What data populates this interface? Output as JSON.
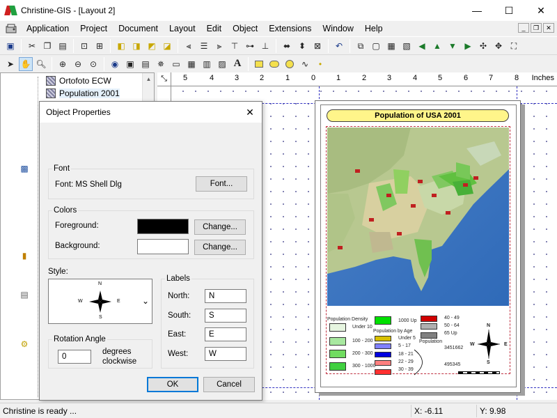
{
  "window": {
    "title": "Christine-GIS - [Layout 2]",
    "minimize": "—",
    "maximize": "☐",
    "close": "✕"
  },
  "menu": {
    "items": [
      "Application",
      "Project",
      "Document",
      "Layout",
      "Edit",
      "Object",
      "Extensions",
      "Window",
      "Help"
    ],
    "mdi": {
      "minimize": "_",
      "restore": "❐",
      "close": "✕"
    }
  },
  "tree": {
    "items": [
      {
        "label": "Ortofoto ECW",
        "selected": false
      },
      {
        "label": "Population 2001",
        "selected": true
      }
    ]
  },
  "ruler": {
    "ticks": [
      "5",
      "4",
      "3",
      "2",
      "1",
      "0",
      "1",
      "2",
      "3",
      "4",
      "5",
      "6",
      "7",
      "8"
    ],
    "unit": "Inches"
  },
  "layout": {
    "map_title": "Population of USA 2001",
    "legend": {
      "density_title": "Population Density",
      "density_items": [
        "Under 10",
        "100 - 200",
        "200 - 300",
        "300 - 1000"
      ],
      "density_extra": "1000 Up",
      "age_title": "Population by Age",
      "age_items": [
        "Under 5",
        "5 - 17",
        "18 - 21",
        "22 - 29",
        "30 - 39"
      ],
      "age_items_right": [
        "40 - 49",
        "50 - 64",
        "65 Up"
      ],
      "population_title": "Population",
      "population_values": [
        "3451662",
        "495345"
      ],
      "compass": {
        "n": "N",
        "s": "S",
        "e": "E",
        "w": "W"
      }
    }
  },
  "dialog": {
    "title": "Object Properties",
    "close": "✕",
    "font_group": "Font",
    "font_label": "Font: MS Shell Dlg",
    "font_button": "Font...",
    "colors_group": "Colors",
    "foreground_label": "Foreground:",
    "foreground_color": "#000000",
    "background_label": "Background:",
    "background_color": "#ffffff",
    "change_button": "Change...",
    "style_label": "Style:",
    "style_compass": {
      "n": "N",
      "s": "S",
      "e": "E",
      "w": "W"
    },
    "rotation_group": "Rotation Angle",
    "rotation_value": "0",
    "rotation_unit_1": "degrees",
    "rotation_unit_2": "clockwise",
    "labels_group": "Labels",
    "north_label": "North:",
    "north_value": "N",
    "south_label": "South:",
    "south_value": "S",
    "east_label": "East:",
    "east_value": "E",
    "west_label": "West:",
    "west_value": "W",
    "ok_button": "OK",
    "cancel_button": "Cancel"
  },
  "status": {
    "message": "Christine is ready ...",
    "x": "X: -6.11",
    "y": "Y: 9.98"
  }
}
